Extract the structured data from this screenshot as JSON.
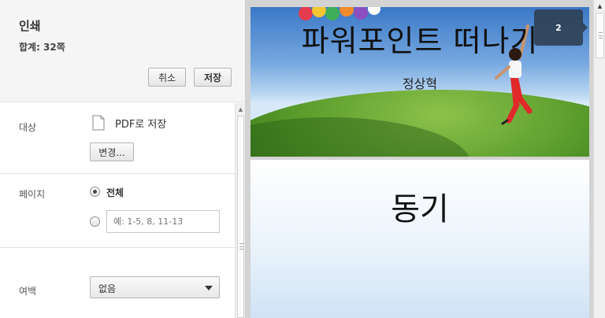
{
  "panel": {
    "title": "인쇄",
    "total": "합계: 32쪽",
    "cancel_label": "취소",
    "save_label": "저장"
  },
  "destination": {
    "label": "대상",
    "name": "PDF로 저장",
    "change_label": "변경..."
  },
  "pages": {
    "label": "페이지",
    "all_label": "전체",
    "all_selected": true,
    "range_placeholder": "예: 1-5, 8, 11-13"
  },
  "margins": {
    "label": "여백",
    "selected": "없음"
  },
  "preview": {
    "slides": [
      {
        "title": "파워포인트 떠나기",
        "subtitle": "정상혁"
      },
      {
        "title": "동기"
      }
    ],
    "page_badge": "2"
  },
  "colors": {
    "header_bg": "#f5f5f5",
    "preview_bg": "#d3d3d3",
    "badge_bg": "#2e3e50"
  },
  "icons": [
    "document-icon",
    "dropdown-caret-icon",
    "scroll-up-arrow-icon",
    "scrollbar-grip-icon"
  ]
}
